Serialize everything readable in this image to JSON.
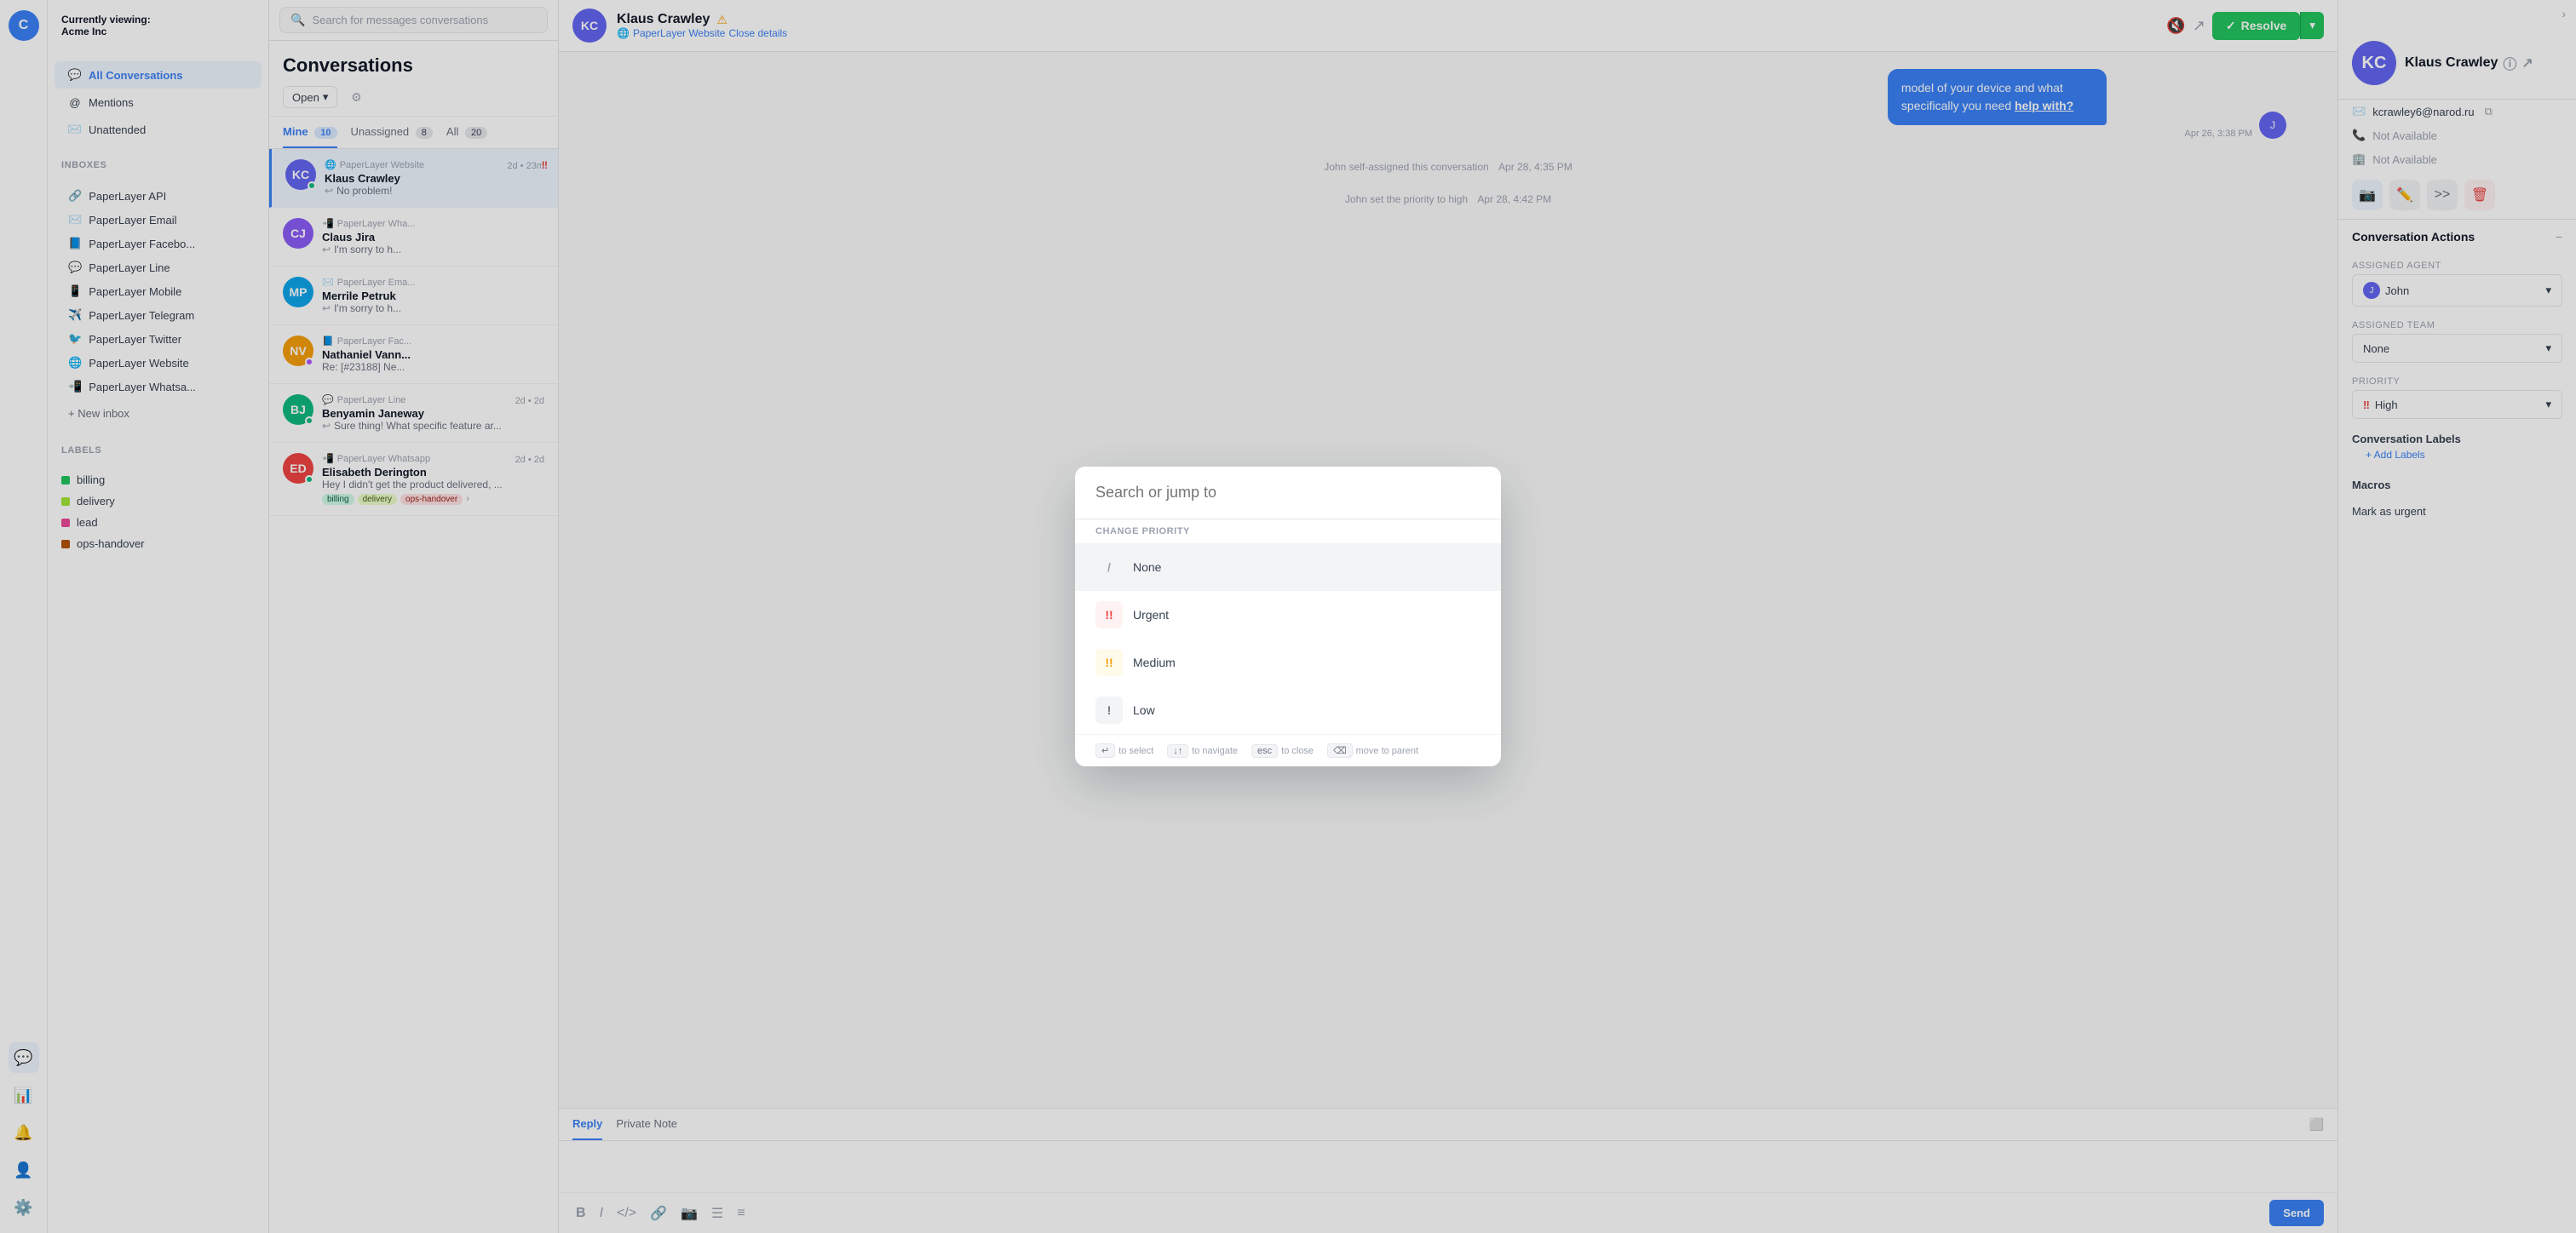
{
  "app": {
    "org_viewing": "Currently viewing:",
    "org_name": "Acme Inc"
  },
  "sidebar": {
    "nav_items": [
      {
        "id": "conversations",
        "label": "All Conversations",
        "icon": "💬",
        "active": true
      },
      {
        "id": "mentions",
        "label": "Mentions",
        "icon": "@"
      },
      {
        "id": "unattended",
        "label": "Unattended",
        "icon": "✉️"
      }
    ],
    "inboxes_title": "Inboxes",
    "inboxes": [
      {
        "id": "api",
        "label": "PaperLayer API",
        "icon": "🔗"
      },
      {
        "id": "email",
        "label": "PaperLayer Email",
        "icon": "✉️"
      },
      {
        "id": "facebook",
        "label": "PaperLayer Facebo...",
        "icon": "📘"
      },
      {
        "id": "line",
        "label": "PaperLayer Line",
        "icon": "💬"
      },
      {
        "id": "mobile",
        "label": "PaperLayer Mobile",
        "icon": "📱"
      },
      {
        "id": "telegram",
        "label": "PaperLayer Telegram",
        "icon": "✈️"
      },
      {
        "id": "twitter",
        "label": "PaperLayer Twitter",
        "icon": "🐦"
      },
      {
        "id": "website",
        "label": "PaperLayer Website",
        "icon": "🌐"
      },
      {
        "id": "whatsapp",
        "label": "PaperLayer Whatsa...",
        "icon": "📲"
      }
    ],
    "new_inbox_label": "+ New inbox",
    "labels_title": "Labels",
    "labels": [
      {
        "id": "billing",
        "label": "billing",
        "color": "#22c55e"
      },
      {
        "id": "delivery",
        "label": "delivery",
        "color": "#a3e635"
      },
      {
        "id": "lead",
        "label": "lead",
        "color": "#ec4899"
      },
      {
        "id": "ops-handover",
        "label": "ops-handover",
        "color": "#b45309"
      }
    ]
  },
  "search": {
    "placeholder": "Search for messages conversations"
  },
  "conv_list": {
    "title": "Conversations",
    "status_label": "Open",
    "tabs": [
      {
        "id": "mine",
        "label": "Mine",
        "count": "10",
        "active": true
      },
      {
        "id": "unassigned",
        "label": "Unassigned",
        "count": "8"
      },
      {
        "id": "all",
        "label": "All",
        "count": "20"
      }
    ],
    "items": [
      {
        "id": "1",
        "source": "PaperLayer Website",
        "name": "Klaus Crawley",
        "preview": "No problem!",
        "time": "2d • 23m",
        "avatar_text": "KC",
        "avatar_bg": "#6366f1",
        "active": true,
        "priority": "high"
      },
      {
        "id": "2",
        "source": "PaperLayer Wha...",
        "name": "Claus Jira",
        "preview": "I'm sorry to h...",
        "time": "",
        "avatar_text": "CJ",
        "avatar_bg": "#8b5cf6",
        "active": false,
        "priority": ""
      },
      {
        "id": "3",
        "source": "PaperLayer Ema...",
        "name": "Merrile Petruk",
        "preview": "I'm sorry to h...",
        "time": "",
        "avatar_text": "MP",
        "avatar_bg": "#0ea5e9",
        "active": false,
        "priority": ""
      },
      {
        "id": "4",
        "source": "PaperLayer Fac...",
        "name": "Nathaniel Vann...",
        "preview": "Re: [#23188] Ne...",
        "time": "",
        "avatar_text": "NV",
        "avatar_bg": "#f59e0b",
        "active": false,
        "priority": ""
      },
      {
        "id": "5",
        "source": "PaperLayer Line",
        "name": "Benyamin Janeway",
        "preview": "Sure thing! What specific feature ar...",
        "time": "2d • 2d",
        "avatar_text": "BJ",
        "avatar_bg": "#10b981",
        "active": false,
        "priority": ""
      },
      {
        "id": "6",
        "source": "PaperLayer Whatsapp",
        "name": "Elisabeth Derington",
        "preview": "Hey I didn't get the product delivered, ...",
        "time": "2d • 2d",
        "avatar_text": "ED",
        "avatar_bg": "#ef4444",
        "active": false,
        "priority": "",
        "badges": [
          {
            "label": "billing",
            "bg": "#d1fae5",
            "color": "#065f46"
          },
          {
            "label": "delivery",
            "bg": "#ecfccb",
            "color": "#3f6212"
          },
          {
            "label": "ops-handover",
            "bg": "#fee2e2",
            "color": "#991b1b"
          }
        ]
      }
    ]
  },
  "chat": {
    "contact_name": "Klaus Crawley",
    "contact_source": "PaperLayer Website",
    "close_details_label": "Close details",
    "resolve_label": "Resolve",
    "messages": [
      {
        "id": "m1",
        "type": "sent",
        "text": "model of your device and what specifically you need help with?",
        "time": "Apr 26, 3:38 PM"
      }
    ],
    "system_messages": [
      {
        "id": "s1",
        "text": "John self-assigned this conversation",
        "time": "Apr 28, 4:35 PM"
      },
      {
        "id": "s2",
        "text": "John set the priority to high",
        "time": "Apr 28, 4:42 PM"
      }
    ],
    "footer": {
      "tabs": [
        {
          "id": "reply",
          "label": "Reply",
          "active": true
        },
        {
          "id": "private-note",
          "label": "Private Note"
        }
      ]
    },
    "toolbar_buttons": [
      "B",
      "I",
      "</>",
      "🔗",
      "📷",
      "☰",
      "≡"
    ]
  },
  "right_sidebar": {
    "contact_name": "Klaus Crawley",
    "contact_email": "kcrawley6@narod.ru",
    "phone": "Not Available",
    "company": "Not Available",
    "actions": [
      {
        "id": "camera",
        "icon": "📷",
        "active": true
      },
      {
        "id": "edit",
        "icon": "✏️"
      },
      {
        "id": "forward",
        "icon": ">>"
      },
      {
        "id": "delete",
        "icon": "🗑️",
        "danger": true
      }
    ],
    "conv_actions_title": "Conversation Actions",
    "assigned_agent_label": "Assigned Agent",
    "assigned_agent": "John",
    "assigned_team_label": "Assigned Team",
    "assigned_team": "None",
    "priority_label": "Priority",
    "priority_value": "High",
    "priority_icon": "!!",
    "conv_labels_title": "Conversation Labels",
    "add_labels_label": "+ Add Labels",
    "macros_title": "Macros",
    "mark_urgent_label": "Mark as urgent"
  },
  "modal": {
    "search_placeholder": "Search or jump to",
    "section_label": "Change Priority",
    "items": [
      {
        "id": "none",
        "label": "None",
        "icon": "/",
        "icon_color": "#9ca3af",
        "icon_bg": "#f3f4f6"
      },
      {
        "id": "urgent",
        "label": "Urgent",
        "icon": "!!",
        "icon_color": "#ef4444",
        "icon_bg": "#fef2f2"
      },
      {
        "id": "medium",
        "label": "Medium",
        "icon": "!!",
        "icon_color": "#f59e0b",
        "icon_bg": "#fffbeb"
      },
      {
        "id": "low",
        "label": "Low",
        "icon": "!",
        "icon_color": "#6b7280",
        "icon_bg": "#f3f4f6"
      }
    ],
    "footer_keys": [
      {
        "key": "↵",
        "label": "to select"
      },
      {
        "key": "↓↑",
        "label": "to navigate"
      },
      {
        "key": "esc",
        "label": "to close"
      },
      {
        "key": "⌫",
        "label": "move to parent"
      }
    ]
  }
}
